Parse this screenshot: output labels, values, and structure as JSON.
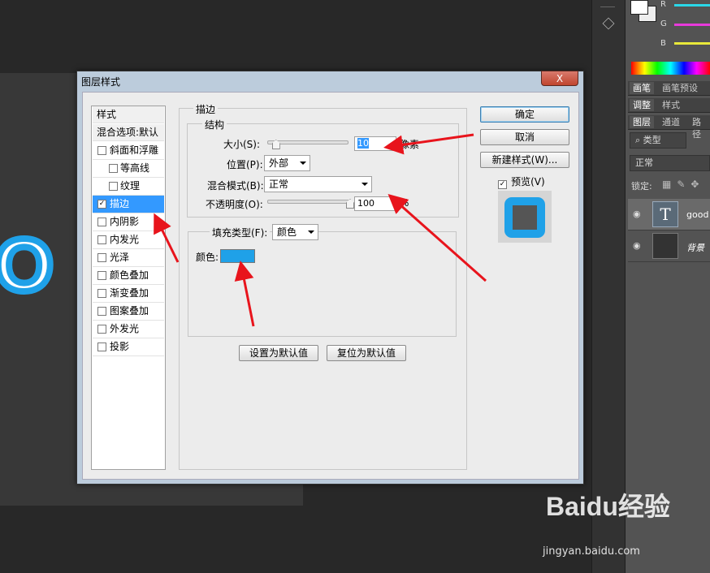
{
  "canvas": {
    "partial_text": "O"
  },
  "right_panel": {
    "color_channels": [
      {
        "label": "R",
        "color": "#2ad7e8"
      },
      {
        "label": "G",
        "color": "#e83adb"
      },
      {
        "label": "B",
        "color": "#e8e83a"
      }
    ],
    "tabs_row1": [
      "画笔",
      "画笔预设"
    ],
    "tabs_row2": [
      "调整",
      "样式"
    ],
    "tabs_row3": [
      "图层",
      "通道",
      "路径"
    ],
    "kind_filter": "类型",
    "blend_mode": "正常",
    "lock_label": "锁定:",
    "layers": [
      {
        "name": "good",
        "thumb": "T"
      },
      {
        "name": "背景",
        "thumb": ""
      }
    ]
  },
  "dialog": {
    "title": "图层样式",
    "close_label": "X",
    "style_list": {
      "header": "样式",
      "blend_options": "混合选项:默认",
      "items": [
        {
          "label": "斜面和浮雕",
          "checked": false,
          "indent": false
        },
        {
          "label": "等高线",
          "checked": false,
          "indent": true
        },
        {
          "label": "纹理",
          "checked": false,
          "indent": true
        },
        {
          "label": "描边",
          "checked": true,
          "indent": false,
          "selected": true
        },
        {
          "label": "内阴影",
          "checked": false,
          "indent": false
        },
        {
          "label": "内发光",
          "checked": false,
          "indent": false
        },
        {
          "label": "光泽",
          "checked": false,
          "indent": false
        },
        {
          "label": "颜色叠加",
          "checked": false,
          "indent": false
        },
        {
          "label": "渐变叠加",
          "checked": false,
          "indent": false
        },
        {
          "label": "图案叠加",
          "checked": false,
          "indent": false
        },
        {
          "label": "外发光",
          "checked": false,
          "indent": false
        },
        {
          "label": "投影",
          "checked": false,
          "indent": false
        }
      ]
    },
    "stroke": {
      "section_title": "描边",
      "structure_title": "结构",
      "size_label": "大小(S):",
      "size_value": "10",
      "size_unit": "像素",
      "size_fraction": 0.05,
      "position_label": "位置(P):",
      "position_value": "外部",
      "blend_label": "混合模式(B):",
      "blend_value": "正常",
      "opacity_label": "不透明度(O):",
      "opacity_value": "100",
      "opacity_unit": "%",
      "opacity_fraction": 1.0,
      "fill_type_label": "填充类型(F):",
      "fill_type_value": "颜色",
      "color_label": "颜色:",
      "color_value": "#1fa1e8"
    },
    "buttons": {
      "ok": "确定",
      "cancel": "取消",
      "new_style": "新建样式(W)...",
      "preview": "预览(V)",
      "preview_checked": true,
      "make_default": "设置为默认值",
      "reset_default": "复位为默认值"
    }
  },
  "watermark": {
    "logo": "Baidu经验",
    "url": "jingyan.baidu.com"
  },
  "colors": {
    "accent": "#1fa1e8",
    "annotation_red": "#e8141c"
  }
}
